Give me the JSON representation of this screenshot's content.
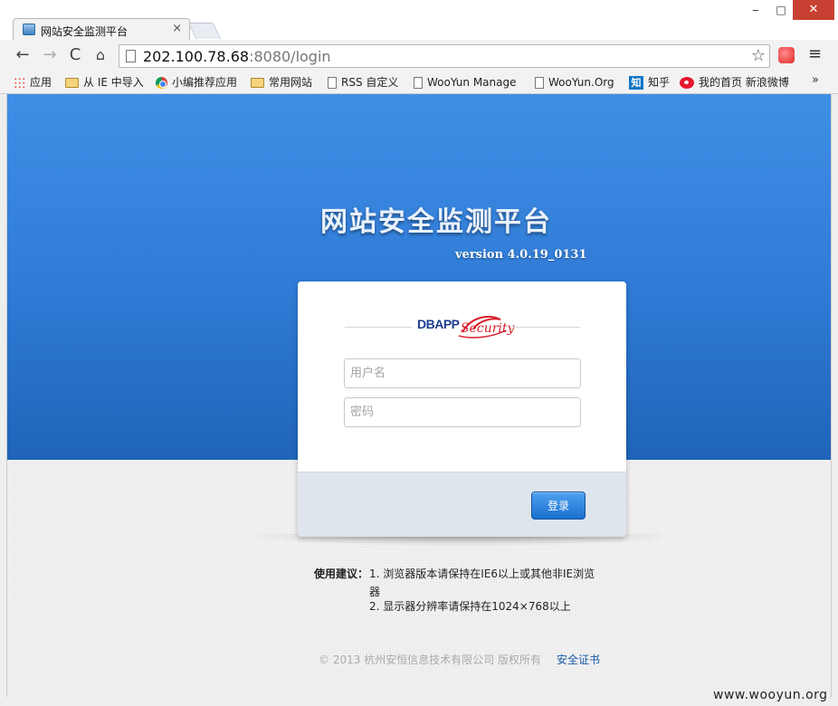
{
  "window": {
    "minimize": "‒",
    "maximize": "□",
    "close": "✕"
  },
  "tab": {
    "title": "网站安全监测平台",
    "close": "×"
  },
  "toolbar": {
    "back": "←",
    "forward": "→",
    "reload": "C",
    "home": "⌂",
    "url_host": "202.100.78.68",
    "url_rest": ":8080/login",
    "star": "☆",
    "menu": "≡"
  },
  "bookmarks": {
    "items": [
      {
        "label": "应用",
        "icon": "apps-icon"
      },
      {
        "label": "从 IE 中导入",
        "icon": "folder-icon"
      },
      {
        "label": "小编推荐应用",
        "icon": "chrome-icon"
      },
      {
        "label": "常用网站",
        "icon": "folder-icon"
      },
      {
        "label": "RSS 自定义",
        "icon": "page-icon"
      },
      {
        "label": "WooYun Manage",
        "icon": "page-icon"
      },
      {
        "label": "WooYun.Org",
        "icon": "page-icon"
      },
      {
        "label": "知乎",
        "icon": "zhihu-icon"
      },
      {
        "label": "我的首页 新浪微博",
        "icon": "weibo-icon"
      }
    ],
    "more": "»",
    "zhihu_glyph": "知"
  },
  "hero": {
    "title": "网站安全监测平台",
    "version": "version 4.0.19_0131"
  },
  "login": {
    "logo_db": "DBAPP",
    "logo_sec": "Security",
    "username_placeholder": "用户名",
    "password_placeholder": "密码",
    "submit": "登录"
  },
  "tips": {
    "label": "使用建议：",
    "item1": "1. 浏览器版本请保持在IE6以上或其他非IE浏览器",
    "item2": "2. 显示器分辨率请保持在1024×768以上"
  },
  "footer": {
    "copyright": "© 2013 杭州安恒信息技术有限公司 版权所有",
    "cert_link": "安全证书"
  },
  "watermark": "www.wooyun.org",
  "colors": {
    "hero_top": "#3f8fe6",
    "hero_bottom": "#1f64b9",
    "button": "#1a6fcf",
    "link": "#1a5aa8"
  }
}
